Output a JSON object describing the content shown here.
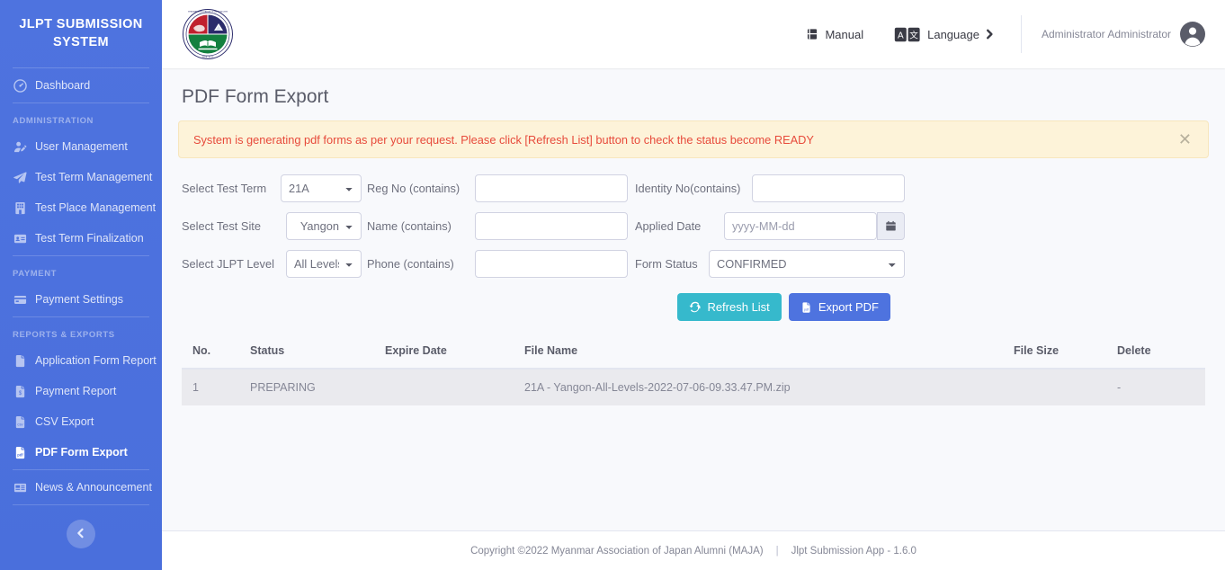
{
  "sidebar": {
    "brand": "JLPT SUBMISSION SYSTEM",
    "dashboard": {
      "label": "Dashboard",
      "icon": "tachometer-icon"
    },
    "sections": [
      {
        "heading": "ADMINISTRATION",
        "items": [
          {
            "label": "User Management",
            "icon": "user-edit-icon"
          },
          {
            "label": "Test Term Management",
            "icon": "paper-plane-icon"
          },
          {
            "label": "Test Place Management",
            "icon": "building-icon"
          },
          {
            "label": "Test Term Finalization",
            "icon": "id-card-icon"
          }
        ]
      },
      {
        "heading": "PAYMENT",
        "items": [
          {
            "label": "Payment Settings",
            "icon": "credit-card-icon"
          }
        ]
      },
      {
        "heading": "REPORTS & EXPORTS",
        "items": [
          {
            "label": "Application Form Report",
            "icon": "file-icon"
          },
          {
            "label": "Payment Report",
            "icon": "file-invoice-dollar-icon"
          },
          {
            "label": "CSV Export",
            "icon": "file-csv-icon"
          },
          {
            "label": "PDF Form Export",
            "icon": "file-pdf-icon"
          },
          {
            "label": "News & Announcement",
            "icon": "newspaper-icon"
          }
        ]
      }
    ],
    "active_item": "PDF Form Export",
    "collapse_icon": "chevron-left-icon",
    "background_color": "#4e73df"
  },
  "topbar": {
    "logo_alt": "maja-logo",
    "manual": {
      "label": "Manual",
      "icon": "book-icon"
    },
    "language": {
      "label": "Language",
      "icon": "translate-icon",
      "chevron": "chevron-right-icon"
    },
    "user": {
      "name": "Administrator Administrator",
      "avatar_icon": "user-circle-icon"
    }
  },
  "page": {
    "title": "PDF Form Export"
  },
  "alert": {
    "message": "System is generating pdf forms as per your request. Please click [Refresh List] button to check the status become READY",
    "close_icon": "close-icon",
    "text_color": "#e74a3b",
    "background_color": "#fdf3d9"
  },
  "filters": {
    "test_term": {
      "label": "Select Test Term",
      "value": "21A",
      "options": [
        "21A"
      ]
    },
    "test_site": {
      "label": "Select Test Site",
      "value": "Yangon",
      "options": [
        "Yangon"
      ]
    },
    "jlpt_level": {
      "label": "Select JLPT Level",
      "value": "All Levels",
      "options": [
        "All Levels"
      ]
    },
    "reg_no": {
      "label": "Reg No (contains)",
      "value": "",
      "placeholder": ""
    },
    "name": {
      "label": "Name (contains)",
      "value": "",
      "placeholder": ""
    },
    "phone": {
      "label": "Phone (contains)",
      "value": "",
      "placeholder": ""
    },
    "identity_no": {
      "label": "Identity No(contains)",
      "value": "",
      "placeholder": ""
    },
    "applied_date": {
      "label": "Applied Date",
      "value": "",
      "placeholder": "yyyy-MM-dd",
      "calendar_icon": "calendar-icon"
    },
    "form_status": {
      "label": "Form Status",
      "value": "CONFIRMED",
      "options": [
        "CONFIRMED"
      ]
    }
  },
  "actions": {
    "refresh": {
      "label": "Refresh List",
      "icon": "sync-icon",
      "color": "#36b9cc"
    },
    "export": {
      "label": "Export PDF",
      "icon": "file-pdf-icon",
      "color": "#4e73df"
    }
  },
  "table": {
    "columns": [
      "No.",
      "Status",
      "Expire Date",
      "File Name",
      "File Size",
      "Delete"
    ],
    "rows": [
      {
        "no": "1",
        "status": "PREPARING",
        "expire_date": "",
        "file_name": "21A - Yangon-All-Levels-2022-07-06-09.33.47.PM.zip",
        "file_size": "",
        "delete": "-"
      }
    ]
  },
  "footer": {
    "copyright": "Copyright ©2022 Myanmar Association of Japan Alumni (MAJA)",
    "separator": "|",
    "app_version": "Jlpt Submission App - 1.6.0"
  }
}
